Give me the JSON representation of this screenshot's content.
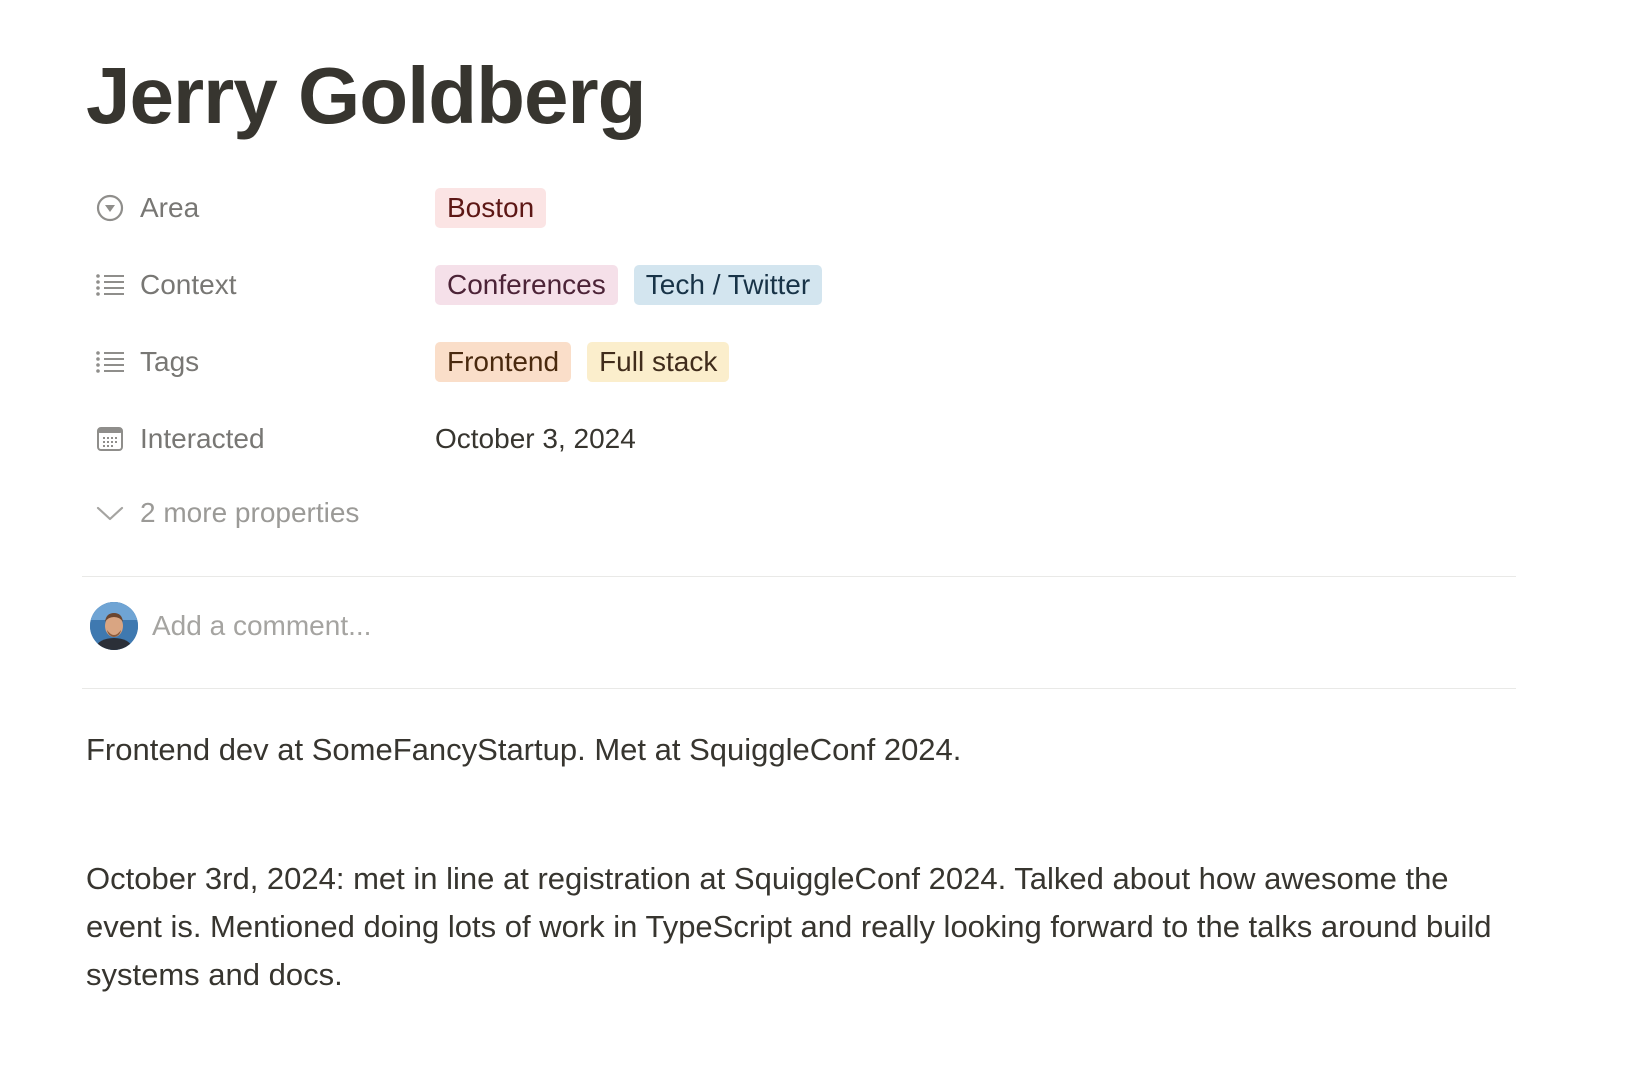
{
  "page": {
    "title": "Jerry Goldberg"
  },
  "properties": [
    {
      "label": "Area",
      "icon": "select-circle-icon",
      "tags": [
        {
          "text": "Boston",
          "color": "#fbe4e4"
        }
      ]
    },
    {
      "label": "Context",
      "icon": "list-icon",
      "tags": [
        {
          "text": "Conferences",
          "color": "#f5e0e9"
        },
        {
          "text": "Tech / Twitter",
          "color": "#d3e5ef"
        }
      ]
    },
    {
      "label": "Tags",
      "icon": "list-icon",
      "tags": [
        {
          "text": "Frontend",
          "color": "#fadec9"
        },
        {
          "text": "Full stack",
          "color": "#fbeecc"
        }
      ]
    },
    {
      "label": "Interacted",
      "icon": "calendar-icon",
      "value": "October 3, 2024"
    }
  ],
  "more_properties": {
    "label": "2 more properties",
    "icon": "chevron-down-icon"
  },
  "comment": {
    "placeholder": "Add a comment..."
  },
  "body": {
    "paragraphs": [
      "Frontend dev at SomeFancyStartup. Met at SquiggleConf 2024.",
      "October 3rd, 2024: met in line at registration at SquiggleConf 2024. Talked about how awesome the event is. Mentioned doing lots of work in TypeScript and really looking forward to the talks around build systems and docs."
    ]
  }
}
